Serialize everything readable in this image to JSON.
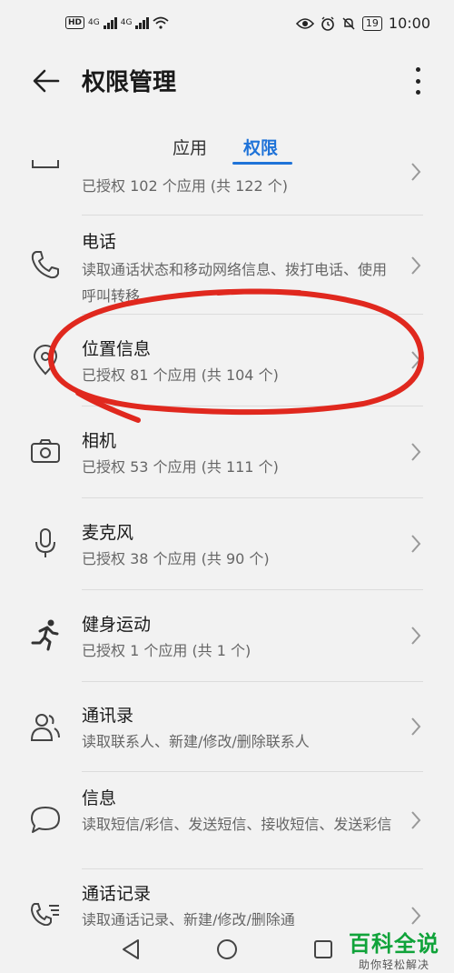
{
  "status_bar": {
    "net1": "4G",
    "net2": "4G",
    "battery": "19",
    "time": "10:00"
  },
  "app_bar": {
    "title": "权限管理",
    "back_icon": "back-arrow-icon",
    "more_icon": "more-vertical-icon"
  },
  "tabs": [
    {
      "label": "应用",
      "selected": false
    },
    {
      "label": "权限",
      "selected": true
    }
  ],
  "accent_color": "#1f73d8",
  "permissions": [
    {
      "name": "",
      "desc": "已授权 102 个应用 (共 122 个)",
      "icon": "storage-icon"
    },
    {
      "name": "电话",
      "desc": "读取通话状态和移动网络信息、拨打电话、使用呼叫转移",
      "icon": "phone-icon"
    },
    {
      "name": "位置信息",
      "desc": "已授权 81 个应用 (共 104 个)",
      "icon": "location-icon"
    },
    {
      "name": "相机",
      "desc": "已授权 53 个应用 (共 111 个)",
      "icon": "camera-icon"
    },
    {
      "name": "麦克风",
      "desc": "已授权 38 个应用 (共 90 个)",
      "icon": "microphone-icon"
    },
    {
      "name": "健身运动",
      "desc": "已授权 1 个应用 (共 1 个)",
      "icon": "running-icon"
    },
    {
      "name": "通讯录",
      "desc": "读取联系人、新建/修改/删除联系人",
      "icon": "contacts-icon"
    },
    {
      "name": "信息",
      "desc": "读取短信/彩信、发送短信、接收短信、发送彩信",
      "icon": "message-icon"
    },
    {
      "name": "通话记录",
      "desc": "读取通话记录、新建/修改/删除通",
      "icon": "call-log-icon"
    }
  ],
  "navigation": {
    "back": "nav-back-icon",
    "home": "nav-home-icon",
    "recents": "nav-recents-icon"
  },
  "watermark": {
    "main": "百科全说",
    "sub": "助你轻松解决"
  }
}
